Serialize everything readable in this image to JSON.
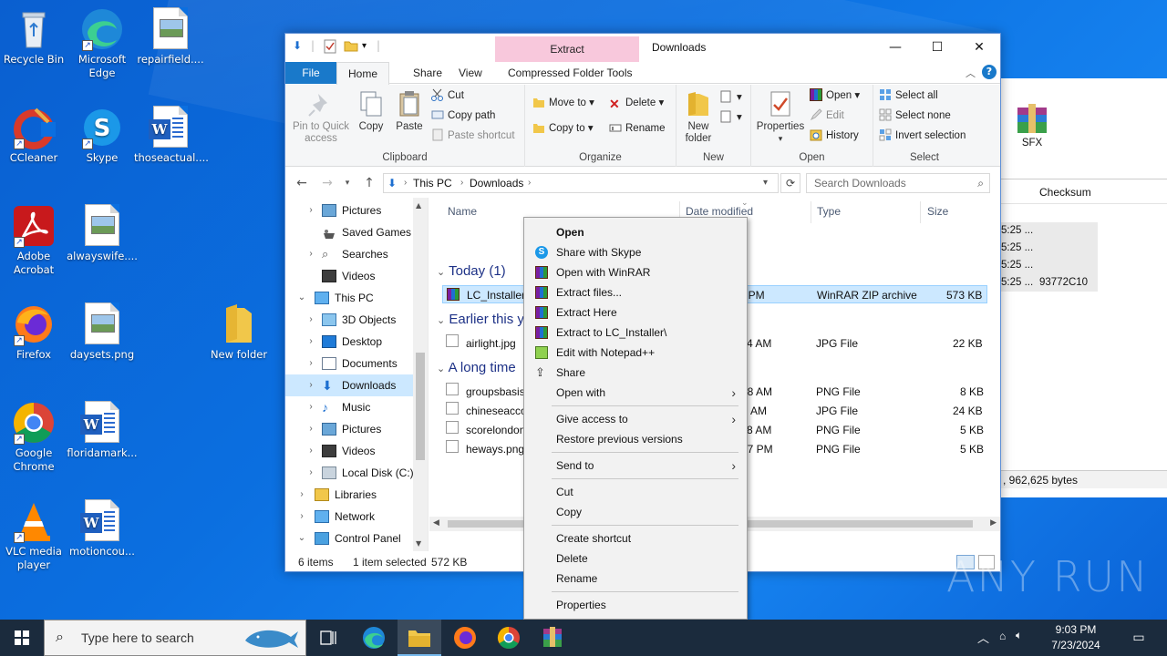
{
  "desktop": {
    "icons": [
      {
        "label": "Recycle Bin"
      },
      {
        "label": "Microsoft Edge"
      },
      {
        "label": "repairfield...."
      },
      {
        "label": "CCleaner"
      },
      {
        "label": "Skype"
      },
      {
        "label": "thoseactual...."
      },
      {
        "label": "Adobe Acrobat"
      },
      {
        "label": "alwayswife...."
      },
      {
        "label": "Firefox"
      },
      {
        "label": "daysets.png"
      },
      {
        "label": "New folder"
      },
      {
        "label": "Google Chrome"
      },
      {
        "label": "floridamark..."
      },
      {
        "label": "VLC media player"
      },
      {
        "label": "motioncou..."
      }
    ]
  },
  "explorer": {
    "title": "Downloads",
    "contextual_tab": "Extract",
    "tabs": {
      "file": "File",
      "home": "Home",
      "share": "Share",
      "view": "View",
      "tools": "Compressed Folder Tools"
    },
    "ribbon": {
      "clipboard": {
        "pin": "Pin to Quick access",
        "copy": "Copy",
        "paste": "Paste",
        "cut": "Cut",
        "copy_path": "Copy path",
        "paste_shortcut": "Paste shortcut",
        "label": "Clipboard"
      },
      "organize": {
        "move_to": "Move to",
        "copy_to": "Copy to",
        "delete": "Delete",
        "rename": "Rename",
        "label": "Organize"
      },
      "new": {
        "new_folder": "New folder",
        "label": "New"
      },
      "open": {
        "properties": "Properties",
        "open": "Open",
        "edit": "Edit",
        "history": "History",
        "label": "Open"
      },
      "select": {
        "select_all": "Select all",
        "select_none": "Select none",
        "invert": "Invert selection",
        "label": "Select"
      }
    },
    "address": {
      "crumb1": "This PC",
      "crumb2": "Downloads"
    },
    "search": {
      "placeholder": "Search Downloads"
    },
    "nav": [
      {
        "label": "Pictures"
      },
      {
        "label": "Saved Games"
      },
      {
        "label": "Searches"
      },
      {
        "label": "Videos"
      },
      {
        "label": "This PC"
      },
      {
        "label": "3D Objects"
      },
      {
        "label": "Desktop"
      },
      {
        "label": "Documents"
      },
      {
        "label": "Downloads"
      },
      {
        "label": "Music"
      },
      {
        "label": "Pictures"
      },
      {
        "label": "Videos"
      },
      {
        "label": "Local Disk (C:)"
      },
      {
        "label": "Libraries"
      },
      {
        "label": "Network"
      },
      {
        "label": "Control Panel"
      }
    ],
    "columns": {
      "name": "Name",
      "date": "Date modified",
      "type": "Type",
      "size": "Size"
    },
    "groups": {
      "today": "Today (1)",
      "earlier": "Earlier this y",
      "longtime": "A long time"
    },
    "files": [
      {
        "name": "LC_Installer.",
        "date": "01 PM",
        "type": "WinRAR ZIP archive",
        "size": "573 KB"
      },
      {
        "name": "airlight.jpg",
        "date": "4 AM",
        "type": "JPG File",
        "size": "22 KB"
      },
      {
        "name": "groupsbasis",
        "date": "08 AM",
        "type": "PNG File",
        "size": "8 KB"
      },
      {
        "name": "chineseacco",
        "date": "AM",
        "type": "JPG File",
        "size": "24 KB"
      },
      {
        "name": "scorelondon",
        "date": "8 AM",
        "type": "PNG File",
        "size": "5 KB"
      },
      {
        "name": "heways.png",
        "date": "27 PM",
        "type": "PNG File",
        "size": "5 KB"
      }
    ],
    "status": {
      "items": "6 items",
      "selected": "1 item selected",
      "size": "572 KB"
    }
  },
  "winrar_bg": {
    "sfx": "SFX",
    "checksum_header": "Checksum",
    "rows": [
      "5:25 ...",
      "5:25 ...",
      "5:25 ...",
      "5:25 ..."
    ],
    "checksum": "93772C10",
    "status": ", 962,625 bytes"
  },
  "context_menu": {
    "items": {
      "open": "Open",
      "share_skype": "Share with Skype",
      "open_winrar": "Open with WinRAR",
      "extract_files": "Extract files...",
      "extract_here": "Extract Here",
      "extract_to": "Extract to LC_Installer\\",
      "edit_npp": "Edit with Notepad++",
      "share": "Share",
      "open_with": "Open with",
      "give_access": "Give access to",
      "restore": "Restore previous versions",
      "send_to": "Send to",
      "cut": "Cut",
      "copy": "Copy",
      "create_shortcut": "Create shortcut",
      "delete": "Delete",
      "rename": "Rename",
      "properties": "Properties"
    }
  },
  "taskbar": {
    "search_placeholder": "Type here to search",
    "time": "9:03 PM",
    "date": "7/23/2024"
  },
  "watermark": "ANY RUN",
  "colors": {
    "accent": "#1979ca",
    "selection": "#cce8ff",
    "extract_tab": "#f8c8dc",
    "taskbar": "#1b2b3d"
  }
}
